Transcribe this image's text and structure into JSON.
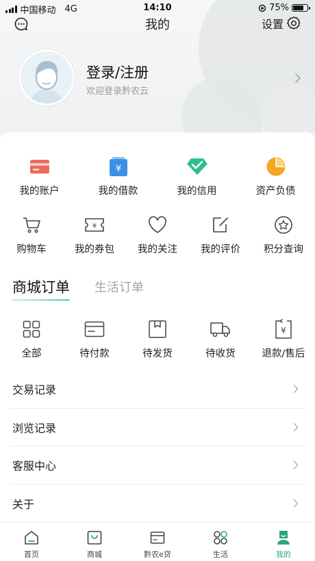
{
  "status": {
    "carrier": "中国移动",
    "network": "4G",
    "time": "14:10",
    "battery": "75%"
  },
  "nav": {
    "title": "我的",
    "settings_label": "设置"
  },
  "profile": {
    "title": "登录/注册",
    "subtitle": "欢迎登录黔农云"
  },
  "finance": [
    {
      "label": "我的账户",
      "icon": "card-icon",
      "color": "#ef6a5a"
    },
    {
      "label": "我的借款",
      "icon": "loan-icon",
      "color": "#3d8fe6"
    },
    {
      "label": "我的信用",
      "icon": "diamond-icon",
      "color": "#2fbf8f"
    },
    {
      "label": "资产负债",
      "icon": "pie-icon",
      "color": "#f5a623"
    }
  ],
  "shortcuts": [
    {
      "label": "购物车",
      "icon": "cart-icon"
    },
    {
      "label": "我的券包",
      "icon": "coupon-icon"
    },
    {
      "label": "我的关注",
      "icon": "heart-icon"
    },
    {
      "label": "我的评价",
      "icon": "edit-icon"
    },
    {
      "label": "积分查询",
      "icon": "star-icon"
    }
  ],
  "order_tabs": {
    "active": "商城订单",
    "inactive": "生活订单"
  },
  "orders": [
    {
      "label": "全部",
      "icon": "grid-icon"
    },
    {
      "label": "待付款",
      "icon": "wallet-icon"
    },
    {
      "label": "待发货",
      "icon": "box-icon"
    },
    {
      "label": "待收货",
      "icon": "truck-icon"
    },
    {
      "label": "退款/售后",
      "icon": "refund-icon"
    }
  ],
  "menu": [
    {
      "label": "交易记录"
    },
    {
      "label": "浏览记录"
    },
    {
      "label": "客服中心"
    },
    {
      "label": "关于"
    }
  ],
  "tabbar": [
    {
      "label": "首页",
      "icon": "home-icon"
    },
    {
      "label": "商城",
      "icon": "shop-icon"
    },
    {
      "label": "黔农e贷",
      "icon": "loan-tab-icon"
    },
    {
      "label": "生活",
      "icon": "life-icon"
    },
    {
      "label": "我的",
      "icon": "user-icon",
      "active": true
    }
  ],
  "colors": {
    "accent": "#2aa978"
  }
}
